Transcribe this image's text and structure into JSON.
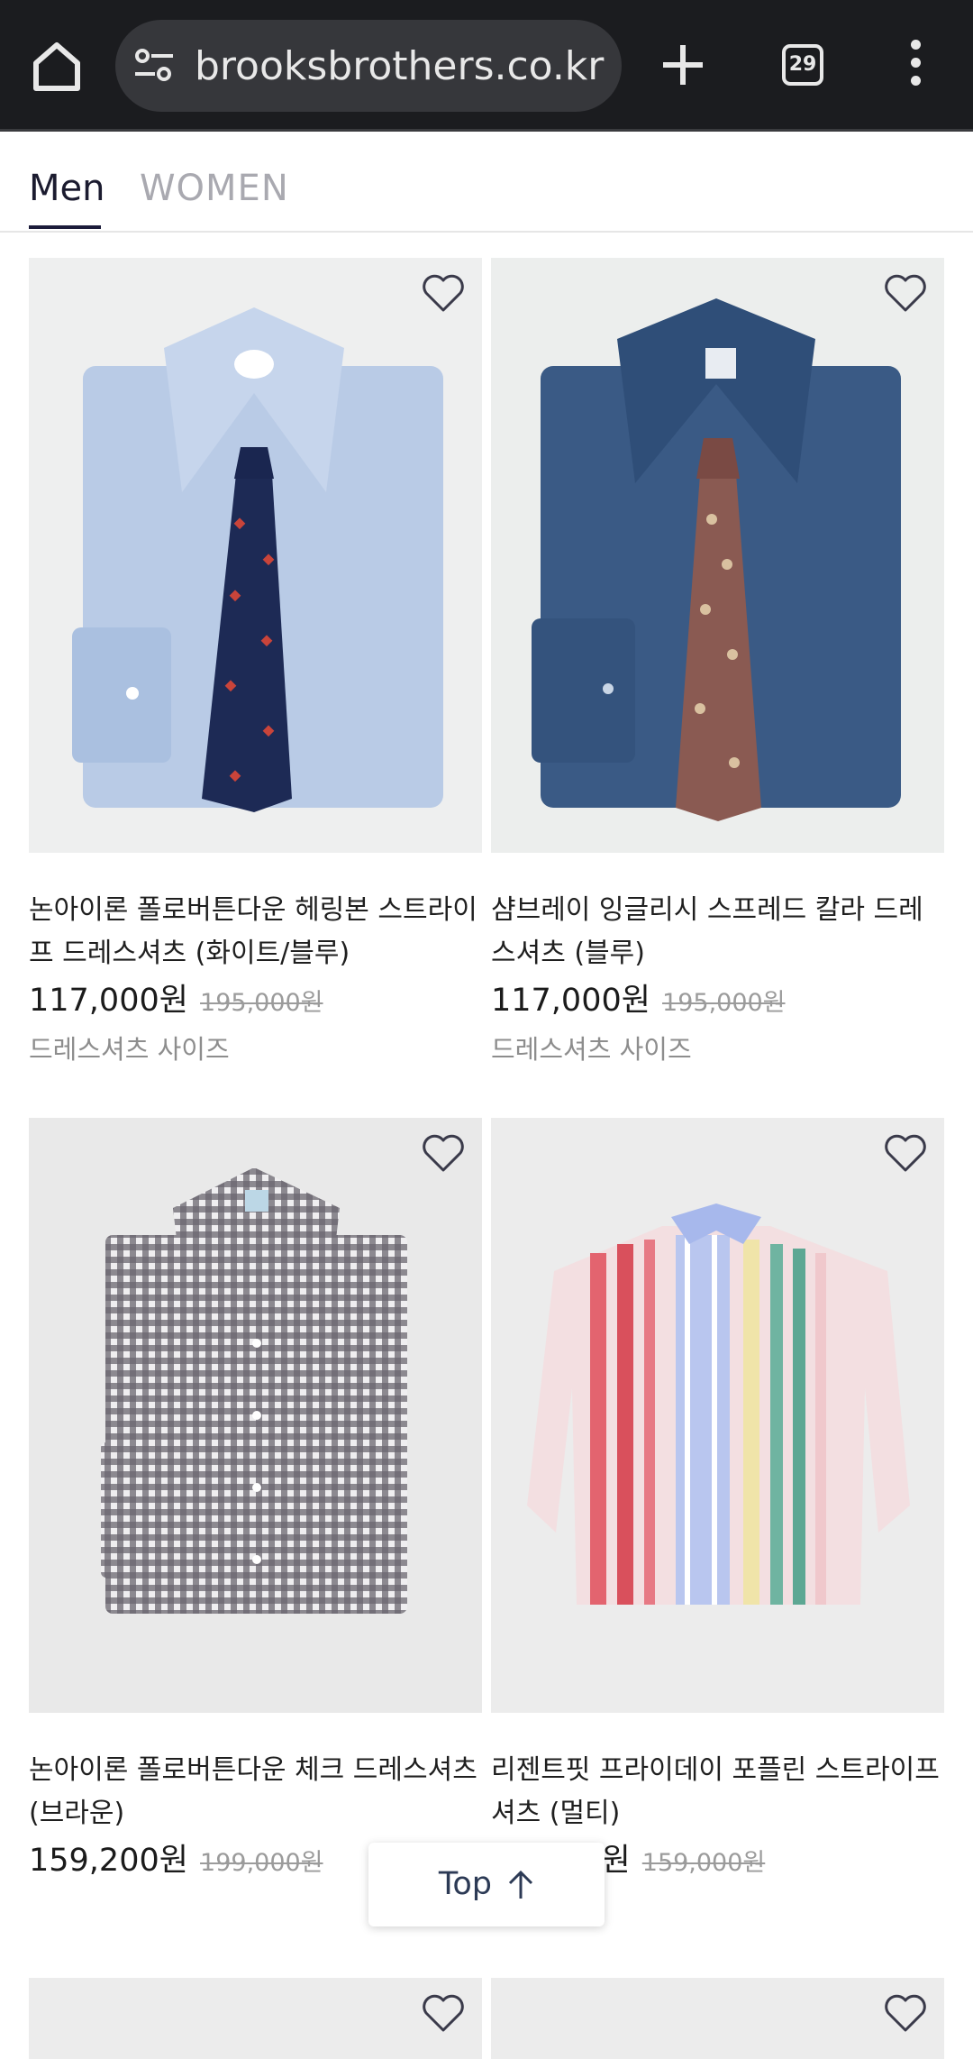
{
  "browser": {
    "url": "brooksbrothers.co.kr",
    "tab_count": "29"
  },
  "gender_tabs": [
    {
      "label": "Men",
      "selected": true
    },
    {
      "label": "WOMEN",
      "selected": false
    }
  ],
  "products": [
    {
      "name": "논아이론 폴로버튼다운 헤링본 스트라이프 드레스셔츠 (화이트/블루)",
      "sale_price": "117,000원",
      "original_price": "195,000원",
      "size_link": "드레스셔츠 사이즈"
    },
    {
      "name": "샴브레이 잉글리시 스프레드 칼라 드레스셔츠 (블루)",
      "sale_price": "117,000원",
      "original_price": "195,000원",
      "size_link": "드레스셔츠 사이즈"
    },
    {
      "name": "논아이론 폴로버튼다운 체크 드레스셔츠 (브라운)",
      "sale_price": "159,200원",
      "original_price": "199,000원",
      "size_link": ""
    },
    {
      "name": "리젠트핏 프라이데이 포플린 스트라이프 셔츠 (멀티)",
      "sale_price": "79,500원",
      "original_price": "159,000원",
      "size_link": ""
    }
  ],
  "top_button": {
    "label": "Top"
  },
  "colors": {
    "chrome_bg": "#1b1c1f",
    "accent": "#1b1b3a"
  }
}
